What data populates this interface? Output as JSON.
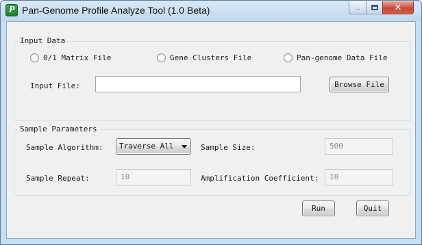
{
  "window": {
    "title": "Pan-Genome Profile Analyze Tool (1.0 Beta)",
    "icon_letter": "P",
    "icon": "app-icon",
    "controls": {
      "minimize": "minimize-icon",
      "maximize": "maximize-icon",
      "close": "close-icon"
    }
  },
  "input_data": {
    "group_label": "Input Data",
    "radio_options": [
      {
        "label": "0/1 Matrix File",
        "selected": false
      },
      {
        "label": "Gene Clusters File",
        "selected": false
      },
      {
        "label": "Pan-genome Data File",
        "selected": false
      }
    ],
    "input_file_label": "Input File:",
    "input_file_value": "",
    "browse_label": "Browse File"
  },
  "sample_parameters": {
    "group_label": "Sample Parameters",
    "algorithm_label": "Sample Algorithm:",
    "algorithm_selected": "Traverse All",
    "sample_size_label": "Sample Size:",
    "sample_size_value": "500",
    "sample_repeat_label": "Sample Repeat:",
    "sample_repeat_value": "10",
    "amplification_label": "Amplification Coefficient:",
    "amplification_value": "10"
  },
  "actions": {
    "run_label": "Run",
    "quit_label": "Quit"
  },
  "colors": {
    "frame": "#c9def1",
    "close_button": "#c74a36",
    "client_background": "#f0f0f0"
  }
}
